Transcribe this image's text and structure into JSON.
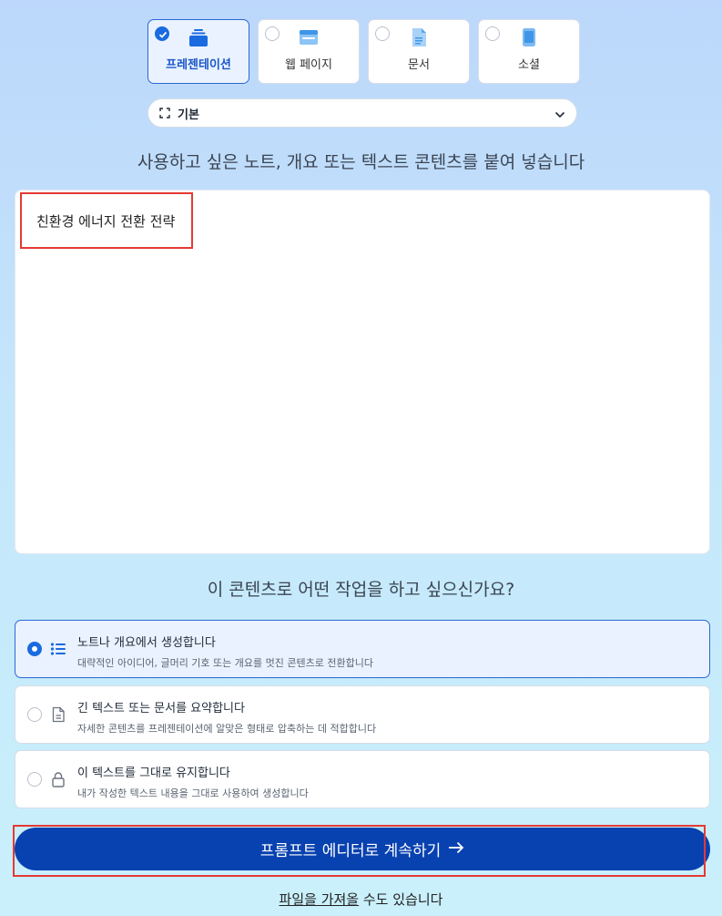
{
  "types": [
    {
      "label": "프레젠테이션",
      "icon": "presentation-stack-icon",
      "selected": true
    },
    {
      "label": "웹 페이지",
      "icon": "web-page-icon",
      "selected": false
    },
    {
      "label": "문서",
      "icon": "document-icon",
      "selected": false
    },
    {
      "label": "소셜",
      "icon": "mobile-phone-icon",
      "selected": false
    }
  ],
  "style_select": {
    "value": "기본",
    "icon": "aspect-frame-icon"
  },
  "paste_prompt": "사용하고 싶은 노트, 개요 또는 텍스트 콘텐츠를 붙여 넣습니다",
  "content_text": "친환경 에너지 전환 전략",
  "action_prompt": "이 콘텐츠로 어떤 작업을 하고 싶으신가요?",
  "options": [
    {
      "title": "노트나 개요에서 생성합니다",
      "desc": "대략적인 아이디어, 글머리 기호 또는 개요를 멋진 콘텐츠로 전환합니다",
      "icon": "list-icon",
      "selected": true
    },
    {
      "title": "긴 텍스트 또는 문서를 요약합니다",
      "desc": "자세한 콘텐츠를 프레젠테이션에 알맞은 형태로 압축하는 데 적합합니다",
      "icon": "document-icon",
      "selected": false
    },
    {
      "title": "이 텍스트를 그대로 유지합니다",
      "desc": "내가 작성한 텍스트 내용을 그대로 사용하여 생성합니다",
      "icon": "lock-icon",
      "selected": false
    }
  ],
  "cta_label": "프롬프트 에디터로 계속하기",
  "footer": {
    "link": "파일을 가져올",
    "rest": " 수도 있습니다"
  },
  "colors": {
    "accent": "#1a6be0",
    "cta": "#0841b0",
    "highlight": "#e53935"
  }
}
